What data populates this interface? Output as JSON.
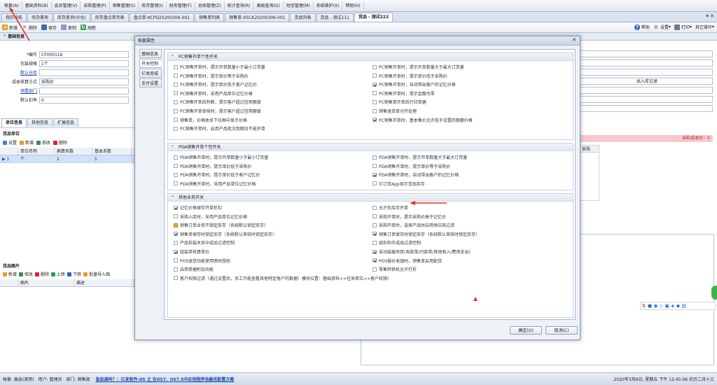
{
  "menu": [
    "帐套(A)",
    "基础资料(B)",
    "会员管理(V)",
    "采购管理(P)",
    "销售管理(S)",
    "库存管理(I)",
    "财务管理(F)",
    "总账管理(Z)",
    "统计查询(R)",
    "高级查询(G)",
    "短信管理(M)",
    "系统维护(X)",
    "帮助(H)"
  ],
  "tabs": [
    "我的导航",
    "待办事项",
    "库存查询(分仓)",
    "库存盘点单列表",
    "盘点单-KCPD20200306-001",
    "销售单列表",
    "销售单-XSCK20200306-001",
    "货品列表",
    "货品 - 测试111",
    "货品 - 测试222"
  ],
  "tab_controls": "▾ ✕",
  "toolbar": {
    "new": "新增",
    "delete": "删除",
    "save": "保存",
    "copy": "复制",
    "refresh": "刷新",
    "help": "帮助",
    "settings": "设置",
    "print": "打印",
    "other": "其它操作"
  },
  "basic": {
    "title": "基础信息",
    "code_label": "*编号",
    "code_value": "CF000116",
    "pack_label": "包装规格",
    "pack_value": "1个",
    "contact_label": "默认仓库",
    "cost_label": "成本核算方式",
    "cost_value": "采购价",
    "supplier_label": "预置部门",
    "discount_label": "默认扣率",
    "discount_value": "0"
  },
  "right_panel": {
    "note": "出入库记录"
  },
  "subtabs": [
    "单位信息",
    "其他信息",
    "扩展信息"
  ],
  "units": {
    "title": "货品单位",
    "buttons": [
      "设置",
      "新增",
      "修改",
      "删除"
    ],
    "columns": [
      "单位名称",
      "换算系数",
      "基本系数"
    ],
    "row": {
      "name": "个",
      "ratio": "1",
      "base": "1"
    },
    "row_marker": "▶ 1"
  },
  "images": {
    "title": "货品图片",
    "buttons": [
      "新增",
      "修改",
      "删除",
      "上移",
      "下移",
      "批量导入图"
    ],
    "columns": [
      "图片",
      "描述"
    ]
  },
  "right_grid": {
    "alert": "当前成本价：0",
    "col": "采购"
  },
  "dialog": {
    "title": "帐套属性",
    "close": "✕",
    "nav": [
      "基础信息",
      "开关控制",
      "亿发商城",
      "支付设置"
    ],
    "pc": {
      "title": "PC销售开单个性开关",
      "left": [
        {
          "t": "PC销售开单时，提示开单数量小于最小订货量",
          "c": false
        },
        {
          "t": "PC销售开单时，提示单价等于采购价",
          "c": false
        },
        {
          "t": "PC销售开单时，提示单价低于客户记忆价",
          "c": false
        },
        {
          "t": "PC销售开单时，采用产品单位记忆价格",
          "c": false
        },
        {
          "t": "PC销售开单后判断，提示客户超过信用额度",
          "c": false
        },
        {
          "t": "PC销售开单审核时，提示客户超过信用额度",
          "c": false
        },
        {
          "t": "销售单，价格体系下拉框中显示价格",
          "c": false
        },
        {
          "t": "PC销售开单时，启用产品批次到期日不能开单",
          "c": false
        }
      ],
      "right": [
        {
          "t": "PC销售开单时，提示开单数量大于最大订货量",
          "c": false
        },
        {
          "t": "PC销售开单时，提示单价低于采购价",
          "c": false
        },
        {
          "t": "PC销售开单时，自动带出客户的记忆价格",
          "c": true
        },
        {
          "t": "PC销售开单时，提示金额为零",
          "c": false
        },
        {
          "t": "PC销售单开单后打印单据",
          "c": false
        },
        {
          "t": "销售退货单分开处理",
          "c": false
        },
        {
          "t": "PC销售开单时，基本售价允许低于设置的限额价格",
          "c": true
        }
      ]
    },
    "pda": {
      "title": "PDA销售开单个性开关",
      "left": [
        {
          "t": "PDA销售开单时，提示开单数量小于最小订货量",
          "c": false
        },
        {
          "t": "PDA销售开单时，提示单价低于采购价",
          "c": false
        },
        {
          "t": "PDA销售开单时，提示单价低于客户记忆价",
          "c": false
        },
        {
          "t": "PDA销售开单时，采用产品单位记忆价格",
          "c": false
        }
      ],
      "right": [
        {
          "t": "PDA销售开单时，提示开单数量大于最大订货量",
          "c": false
        },
        {
          "t": "PDA销售开单时，提示单价等于采购价",
          "c": false
        },
        {
          "t": "PDA销售开单时，自动带出客户的记忆价格",
          "c": true
        },
        {
          "t": "亿订货App显示货品库存",
          "c": false
        }
      ]
    },
    "other": {
      "title": "其他业务开关",
      "left": [
        {
          "t": "记忆价格保存开单折扣",
          "c": true
        },
        {
          "t": "采购入库时，采用产品单位记忆价格",
          "c": false
        },
        {
          "t": "销售订单业务不锁定库存（系统默认锁定库存）",
          "c": "ind"
        },
        {
          "t": "销售单保存时锁定库存（系统默认审核时锁定库存）",
          "c": true
        },
        {
          "t": "产品拆装关系中成品过滤控制",
          "c": false
        },
        {
          "t": "组装单核算单价",
          "c": true
        },
        {
          "t": "POS退货功能使用密码授权",
          "c": false
        },
        {
          "t": "启用单据附加功能",
          "c": false
        },
        {
          "t": "客户权限过滤（通过设置后，员工只能查看其他特定客户的数据）模块位置：基础资料>>往来单位>>客户权限）",
          "c": false
        }
      ],
      "right": [
        {
          "t": "允许负库存开单",
          "c": false
        },
        {
          "t": "采购开单时，提示采购价高于记忆价",
          "c": false
        },
        {
          "t": "采购开单时，选择产品时启用供应商过滤",
          "c": false
        },
        {
          "t": "销售订单保存时锁定库存（系统默认审核时锁定库存）",
          "c": true
        },
        {
          "t": "组拆和半成品过滤控制",
          "c": false
        },
        {
          "t": "自动装载项目(收款单/付款单/其他收入/费用支出)",
          "c": true
        },
        {
          "t": "POS报价收银时，销售单启用配货",
          "c": true
        },
        {
          "t": "零售转移机允许打折",
          "c": false
        }
      ]
    },
    "ok": "确定(O)",
    "cancel": "取消(C)"
  },
  "status": {
    "left": "帐套: 展会(测用)　用户: 管理员　部门: 销售部",
    "link": "急如调吗？：亿发软件-IIS 之 在IIS7、IIS7.5中应用程序池最优配置方案",
    "right": "2020年3月6日, 星期五 下午 12:45:06 农历二月十三"
  },
  "colors": {
    "arrow": "#e0322b",
    "link": "#1646b8",
    "alert_bg": "#f6c9cf",
    "alert_fg": "#c01e2d"
  }
}
